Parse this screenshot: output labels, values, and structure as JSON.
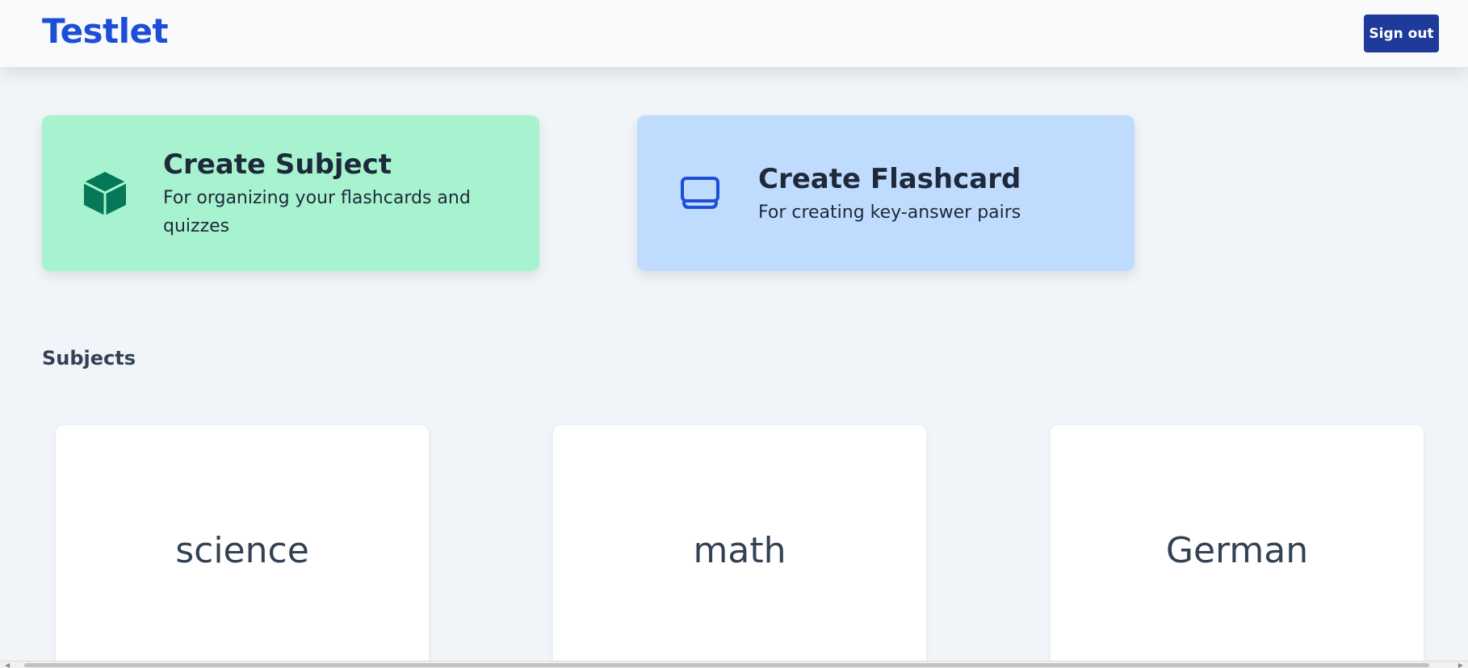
{
  "app": {
    "title": "Testlet"
  },
  "header": {
    "signout_label": "Sign out"
  },
  "actions": {
    "create_subject": {
      "title": "Create Subject",
      "description": "For organizing your flashcards and quizzes",
      "icon": "cube-icon"
    },
    "create_flashcard": {
      "title": "Create Flashcard",
      "description": "For creating key-answer pairs",
      "icon": "flashcard-icon"
    }
  },
  "subjects": {
    "heading": "Subjects",
    "items": [
      {
        "name": "science"
      },
      {
        "name": "math"
      },
      {
        "name": "German"
      }
    ]
  },
  "colors": {
    "brand": "#1d4ed8",
    "signout_bg": "#1e3a9a",
    "subject_card_bg": "#a7f3d0",
    "flashcard_card_bg": "#bfdbfe",
    "cube_icon": "#047857",
    "flashcard_icon": "#1d4ed8",
    "page_bg": "#f1f4f8"
  }
}
